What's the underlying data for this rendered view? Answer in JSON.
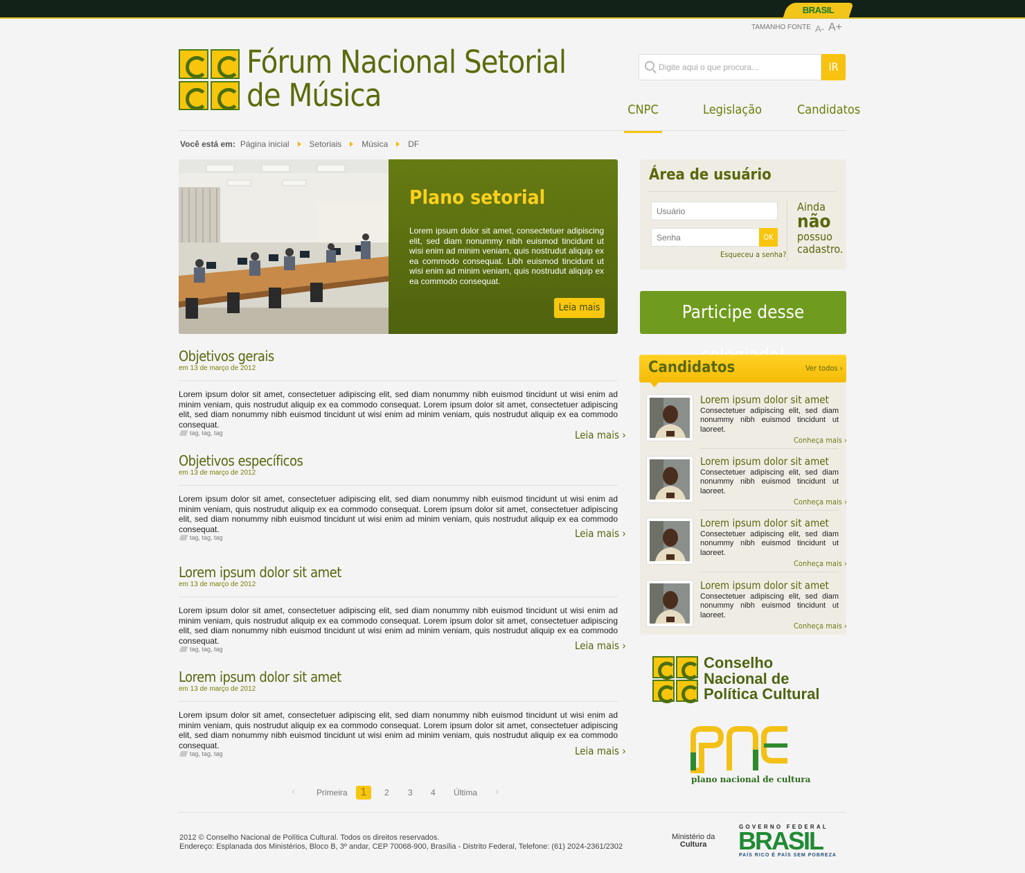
{
  "topbar": {
    "brasil_label": "BRASIL"
  },
  "accessibility": {
    "font_size_label": "TAMANHO FONTE",
    "decrease_label": "A-",
    "increase_label": "A+"
  },
  "site": {
    "title_line1": "Fórum Nacional Setorial",
    "title_line2": "de Música"
  },
  "search": {
    "placeholder": "Digite aqui o que procura...",
    "button_label": "IR"
  },
  "nav": {
    "items": [
      {
        "label": "CNPC"
      },
      {
        "label": "Legislação"
      },
      {
        "label": "Candidatos"
      }
    ]
  },
  "breadcrumb": {
    "lead": "Você está em:",
    "items": [
      "Página inicial",
      "Setoriais",
      "Música",
      "DF"
    ]
  },
  "featured": {
    "title": "Plano setorial",
    "text": "Lorem ipsum dolor sit amet, consectetuer adipiscing elit, sed diam nonummy nibh euismod tincidunt ut wisi enim ad minim veniam, quis nostrudut aliquip ex ea commodo consequat. Libh euismod tincidunt ut wisi enim ad minim veniam, quis nostrudut aliquip ex ea commodo consequat.",
    "more_label": "Leia mais"
  },
  "articles": [
    {
      "title": "Objetivos gerais",
      "date": "em 13 de março de 2012",
      "body": "Lorem ipsum dolor sit amet, consectetuer adipiscing elit, sed diam nonummy nibh euismod tincidunt ut wisi enim ad minim veniam, quis nostrudut aliquip ex ea commodo consequat. Lorem ipsum dolor sit amet, consectetuer adipiscing elit, sed diam nonummy nibh euismod tincidunt ut wisi enim ad minim veniam, quis nostrudut aliquip ex ea commodo consequat.",
      "tags": "tag, tag, tag",
      "more": "Leia mais ›"
    },
    {
      "title": "Objetivos específicos",
      "date": "em 13 de março de 2012",
      "body": "Lorem ipsum dolor sit amet, consectetuer adipiscing elit, sed diam nonummy nibh euismod tincidunt ut wisi enim ad minim veniam, quis nostrudut aliquip ex ea commodo consequat. Lorem ipsum dolor sit amet, consectetuer adipiscing elit, sed diam nonummy nibh euismod tincidunt ut wisi enim ad minim veniam, quis nostrudut aliquip ex ea commodo consequat.",
      "tags": "tag, tag, tag",
      "more": "Leia mais ›"
    },
    {
      "title": "Lorem ipsum dolor sit amet",
      "date": "em 13 de março de 2012",
      "body": "Lorem ipsum dolor sit amet, consectetuer adipiscing elit, sed diam nonummy nibh euismod tincidunt ut wisi enim ad minim veniam, quis nostrudut aliquip ex ea commodo consequat. Lorem ipsum dolor sit amet, consectetuer adipiscing elit, sed diam nonummy nibh euismod tincidunt ut wisi enim ad minim veniam, quis nostrudut aliquip ex ea commodo consequat.",
      "tags": "tag, tag, tag",
      "more": "Leia mais ›"
    },
    {
      "title": "Lorem ipsum dolor sit amet",
      "date": "em 13 de março de 2012",
      "body": "Lorem ipsum dolor sit amet, consectetuer adipiscing elit, sed diam nonummy nibh euismod tincidunt ut wisi enim ad minim veniam, quis nostrudut aliquip ex ea commodo consequat. Lorem ipsum dolor sit amet, consectetuer adipiscing elit, sed diam nonummy nibh euismod tincidunt ut wisi enim ad minim veniam, quis nostrudut aliquip ex ea commodo consequat.",
      "tags": "tag, tag, tag",
      "more": "Leia mais ›"
    }
  ],
  "pagination": {
    "prev": "‹",
    "first": "Primeira",
    "pages": [
      "1",
      "2",
      "3",
      "4"
    ],
    "current": "1",
    "last": "Última",
    "next": "›"
  },
  "user_area": {
    "title": "Área de usuário",
    "username_placeholder": "Usuário",
    "password_placeholder": "Senha",
    "ok_label": "OK",
    "forgot_label": "Esqueceu a senha?",
    "signup_line1": "Ainda",
    "signup_line2": "não",
    "signup_line3": "possuo",
    "signup_line4": "cadastro."
  },
  "participe": {
    "label": "Participe desse colegiado!"
  },
  "candidates": {
    "title": "Candidatos",
    "view_all": "Ver todos ›",
    "items": [
      {
        "name": "Lorem ipsum dolor sit amet",
        "desc": "Consectetuer adipiscing elit, sed diam nonummy nibh euismod tincidunt ut laoreet.",
        "more": "Conheça mais ›"
      },
      {
        "name": "Lorem ipsum dolor sit amet",
        "desc": "Consectetuer adipiscing elit, sed diam nonummy nibh euismod tincidunt ut laoreet.",
        "more": "Conheça mais ›"
      },
      {
        "name": "Lorem ipsum dolor sit amet",
        "desc": "Consectetuer adipiscing elit, sed diam nonummy nibh euismod tincidunt ut laoreet.",
        "more": "Conheça mais ›"
      },
      {
        "name": "Lorem ipsum dolor sit amet",
        "desc": "Consectetuer adipiscing elit, sed diam nonummy nibh euismod tincidunt ut laoreet.",
        "more": "Conheça mais ›"
      }
    ]
  },
  "partners": {
    "cnpc_line1": "Conselho",
    "cnpc_line2": "Nacional de",
    "cnpc_line3": "Política Cultural",
    "pnc_caption": "plano nacional de cultura"
  },
  "footer": {
    "line1": "2012 © Conselho Nacional de Política Cultural. Todos os direitos reservados.",
    "line2": "Endereço: Esplanada dos Ministérios, Bloco B, 3º andar, CEP 70068-900, Brasília - Distrito Federal, Telefone: (61) 2024-2361/2302",
    "minc_line1": "Ministério da",
    "minc_line2": "Cultura",
    "gov_top": "GOVERNO FEDERAL",
    "gov_brasil": "BRASIL",
    "gov_slogan": "PAÍS RICO É PAÍS SEM POBREZA"
  },
  "colors": {
    "olive": "#5a680b",
    "yellow": "#f8c60f",
    "green": "#6f9b1e",
    "topbar": "#132218"
  }
}
